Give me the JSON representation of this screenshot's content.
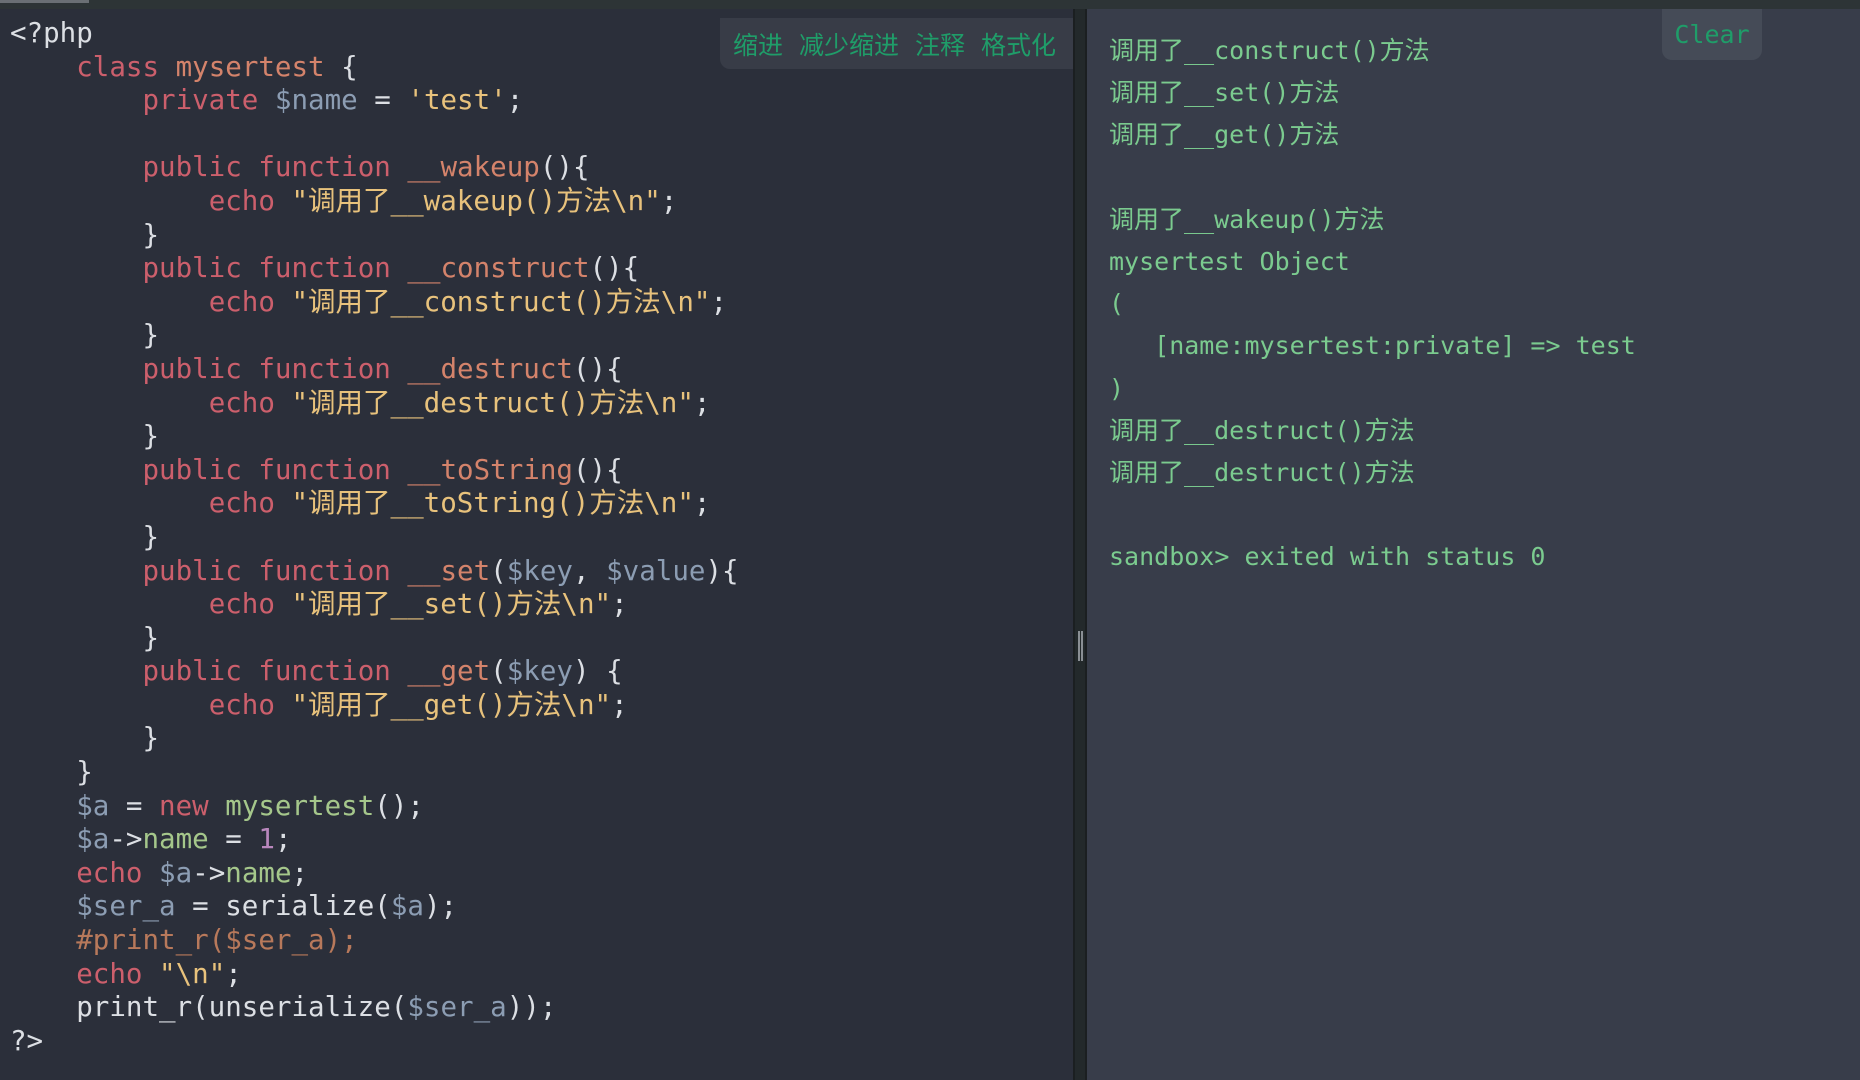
{
  "toolbar": {
    "indent": "缩进",
    "outdent": "减少缩进",
    "comment": "注释",
    "format": "格式化"
  },
  "output_panel": {
    "clear_label": "Clear",
    "lines": [
      "调用了__construct()方法",
      "调用了__set()方法",
      "调用了__get()方法",
      "",
      "调用了__wakeup()方法",
      "mysertest Object",
      "(",
      "   [name:mysertest:private] => test",
      ")",
      "调用了__destruct()方法",
      "调用了__destruct()方法",
      "",
      "sandbox> exited with status 0"
    ]
  },
  "colors": {
    "keyword": "#cc5f6c",
    "function_name": "#d4836b",
    "string": "#e8c27c",
    "variable": "#8c9db3",
    "property": "#a5c78b",
    "number": "#b987bd",
    "comment": "#b8795b",
    "output_text": "#7bcb8f",
    "button_text": "#1f9d69"
  },
  "code": [
    [
      [
        "plain",
        "<?php"
      ]
    ],
    [
      [
        "plain",
        "    "
      ],
      [
        "kw",
        "class"
      ],
      [
        "plain",
        " "
      ],
      [
        "fn",
        "mysertest"
      ],
      [
        "plain",
        " {"
      ]
    ],
    [
      [
        "plain",
        "        "
      ],
      [
        "kw",
        "private"
      ],
      [
        "plain",
        " "
      ],
      [
        "var",
        "$name"
      ],
      [
        "plain",
        " = "
      ],
      [
        "str",
        "'test'"
      ],
      [
        "plain",
        ";"
      ]
    ],
    [],
    [
      [
        "plain",
        "        "
      ],
      [
        "kw",
        "public"
      ],
      [
        "plain",
        " "
      ],
      [
        "kw",
        "function"
      ],
      [
        "plain",
        " "
      ],
      [
        "fn",
        "__wakeup"
      ],
      [
        "plain",
        "(){"
      ]
    ],
    [
      [
        "plain",
        "            "
      ],
      [
        "kw",
        "echo"
      ],
      [
        "plain",
        " "
      ],
      [
        "str",
        "\"调用了__wakeup()方法\\n\""
      ],
      [
        "plain",
        ";"
      ]
    ],
    [
      [
        "plain",
        "        }"
      ]
    ],
    [
      [
        "plain",
        "        "
      ],
      [
        "kw",
        "public"
      ],
      [
        "plain",
        " "
      ],
      [
        "kw",
        "function"
      ],
      [
        "plain",
        " "
      ],
      [
        "fn",
        "__construct"
      ],
      [
        "plain",
        "(){"
      ]
    ],
    [
      [
        "plain",
        "            "
      ],
      [
        "kw",
        "echo"
      ],
      [
        "plain",
        " "
      ],
      [
        "str",
        "\"调用了__construct()方法\\n\""
      ],
      [
        "plain",
        ";"
      ]
    ],
    [
      [
        "plain",
        "        }"
      ]
    ],
    [
      [
        "plain",
        "        "
      ],
      [
        "kw",
        "public"
      ],
      [
        "plain",
        " "
      ],
      [
        "kw",
        "function"
      ],
      [
        "plain",
        " "
      ],
      [
        "fn",
        "__destruct"
      ],
      [
        "plain",
        "(){"
      ]
    ],
    [
      [
        "plain",
        "            "
      ],
      [
        "kw",
        "echo"
      ],
      [
        "plain",
        " "
      ],
      [
        "str",
        "\"调用了__destruct()方法\\n\""
      ],
      [
        "plain",
        ";"
      ]
    ],
    [
      [
        "plain",
        "        }"
      ]
    ],
    [
      [
        "plain",
        "        "
      ],
      [
        "kw",
        "public"
      ],
      [
        "plain",
        " "
      ],
      [
        "kw",
        "function"
      ],
      [
        "plain",
        " "
      ],
      [
        "fn",
        "__toString"
      ],
      [
        "plain",
        "(){"
      ]
    ],
    [
      [
        "plain",
        "            "
      ],
      [
        "kw",
        "echo"
      ],
      [
        "plain",
        " "
      ],
      [
        "str",
        "\"调用了__toString()方法\\n\""
      ],
      [
        "plain",
        ";"
      ]
    ],
    [
      [
        "plain",
        "        }"
      ]
    ],
    [
      [
        "plain",
        "        "
      ],
      [
        "kw",
        "public"
      ],
      [
        "plain",
        " "
      ],
      [
        "kw",
        "function"
      ],
      [
        "plain",
        " "
      ],
      [
        "fn",
        "__set"
      ],
      [
        "plain",
        "("
      ],
      [
        "var",
        "$key"
      ],
      [
        "plain",
        ", "
      ],
      [
        "var",
        "$value"
      ],
      [
        "plain",
        "){"
      ]
    ],
    [
      [
        "plain",
        "            "
      ],
      [
        "kw",
        "echo"
      ],
      [
        "plain",
        " "
      ],
      [
        "str",
        "\"调用了__set()方法\\n\""
      ],
      [
        "plain",
        ";"
      ]
    ],
    [
      [
        "plain",
        "        }"
      ]
    ],
    [
      [
        "plain",
        "        "
      ],
      [
        "kw",
        "public"
      ],
      [
        "plain",
        " "
      ],
      [
        "kw",
        "function"
      ],
      [
        "plain",
        " "
      ],
      [
        "fn",
        "__get"
      ],
      [
        "plain",
        "("
      ],
      [
        "var",
        "$key"
      ],
      [
        "plain",
        ") {"
      ]
    ],
    [
      [
        "plain",
        "            "
      ],
      [
        "kw",
        "echo"
      ],
      [
        "plain",
        " "
      ],
      [
        "str",
        "\"调用了__get()方法\\n\""
      ],
      [
        "plain",
        ";"
      ]
    ],
    [
      [
        "plain",
        "        }"
      ]
    ],
    [
      [
        "plain",
        "    }"
      ]
    ],
    [
      [
        "plain",
        "    "
      ],
      [
        "var",
        "$a"
      ],
      [
        "plain",
        " = "
      ],
      [
        "kw",
        "new"
      ],
      [
        "plain",
        " "
      ],
      [
        "prop",
        "mysertest"
      ],
      [
        "plain",
        "();"
      ]
    ],
    [
      [
        "plain",
        "    "
      ],
      [
        "var",
        "$a"
      ],
      [
        "plain",
        "->"
      ],
      [
        "prop",
        "name"
      ],
      [
        "plain",
        " = "
      ],
      [
        "num",
        "1"
      ],
      [
        "plain",
        ";"
      ]
    ],
    [
      [
        "plain",
        "    "
      ],
      [
        "kw",
        "echo"
      ],
      [
        "plain",
        " "
      ],
      [
        "var",
        "$a"
      ],
      [
        "plain",
        "->"
      ],
      [
        "prop",
        "name"
      ],
      [
        "plain",
        ";"
      ]
    ],
    [
      [
        "plain",
        "    "
      ],
      [
        "var",
        "$ser_a"
      ],
      [
        "plain",
        " = serialize("
      ],
      [
        "var",
        "$a"
      ],
      [
        "plain",
        ");"
      ]
    ],
    [
      [
        "plain",
        "    "
      ],
      [
        "cmt",
        "#print_r($ser_a);"
      ]
    ],
    [
      [
        "plain",
        "    "
      ],
      [
        "kw",
        "echo"
      ],
      [
        "plain",
        " "
      ],
      [
        "str",
        "\"\\n\""
      ],
      [
        "plain",
        ";"
      ]
    ],
    [
      [
        "plain",
        "    print_r(unserialize("
      ],
      [
        "var",
        "$ser_a"
      ],
      [
        "plain",
        "));"
      ]
    ],
    [
      [
        "plain",
        "?>"
      ]
    ]
  ]
}
